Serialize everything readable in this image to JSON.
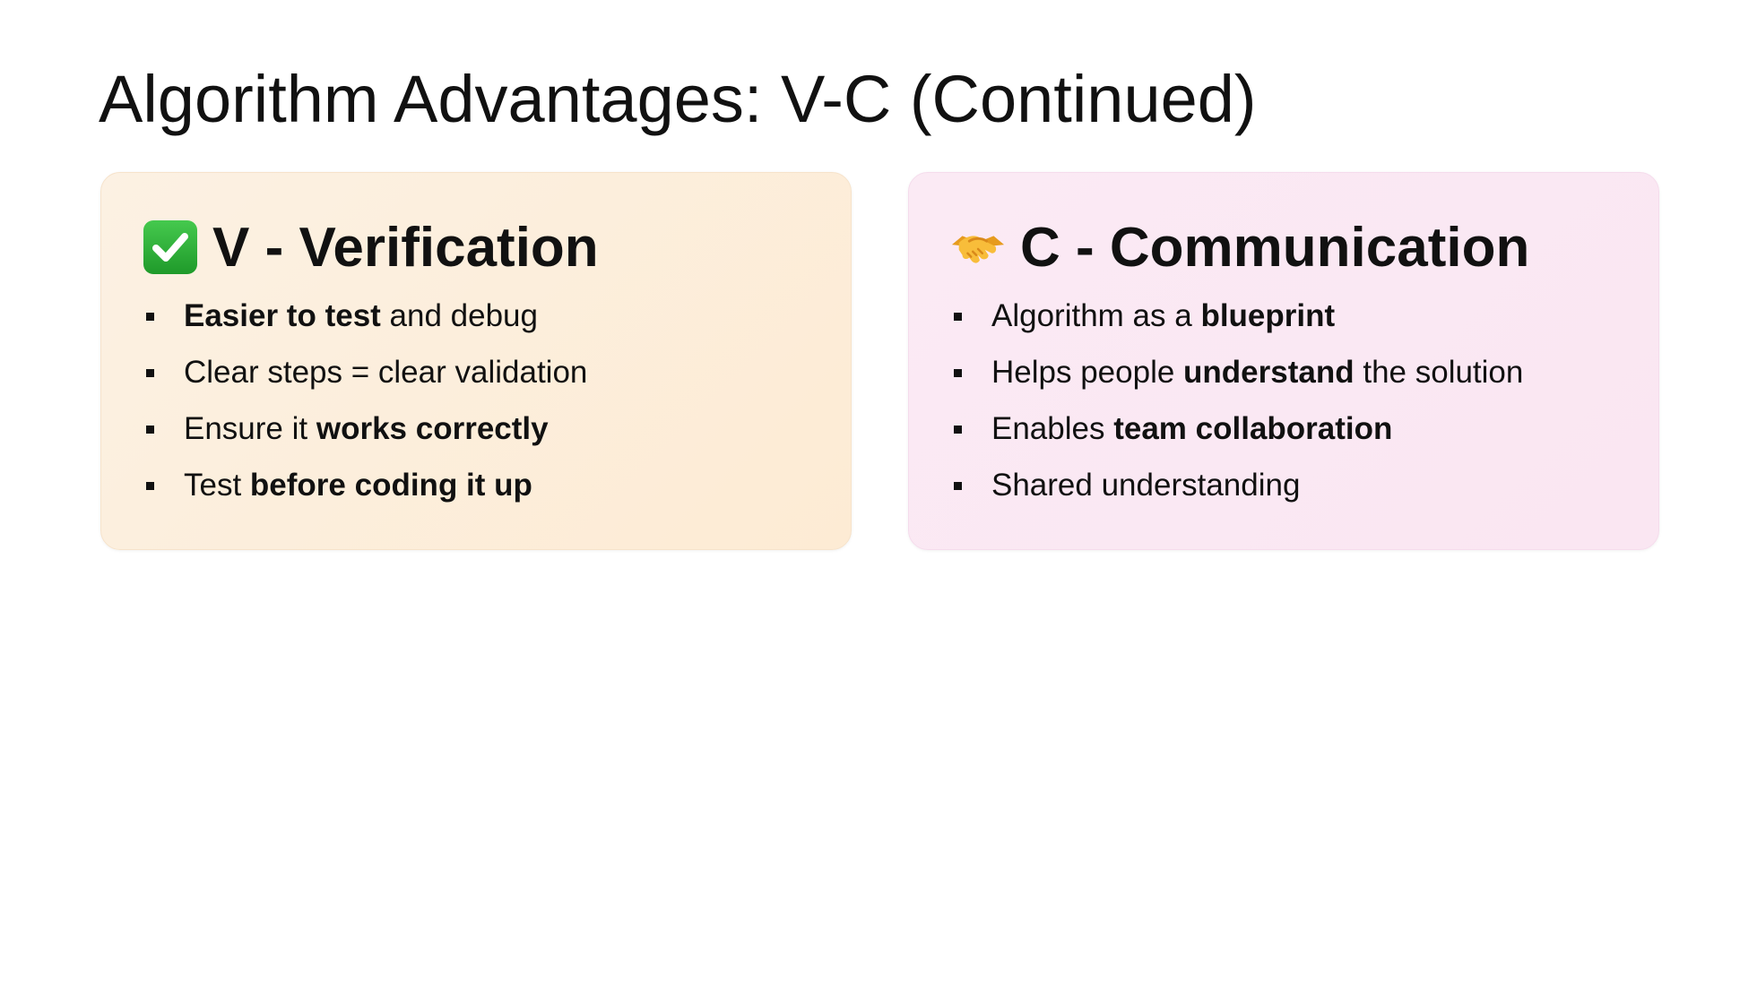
{
  "slide": {
    "title": "Algorithm Advantages: V-C (Continued)"
  },
  "cards": [
    {
      "heading": "V - Verification",
      "icon": "check-mark-box-icon",
      "accent": "#2fb33a",
      "items": [
        [
          {
            "t": "Easier to test",
            "b": true
          },
          {
            "t": " and debug",
            "b": false
          }
        ],
        [
          {
            "t": "Clear steps = clear validation",
            "b": false
          }
        ],
        [
          {
            "t": "Ensure it ",
            "b": false
          },
          {
            "t": "works correctly",
            "b": true
          }
        ],
        [
          {
            "t": "Test ",
            "b": false
          },
          {
            "t": "before coding it up",
            "b": true
          }
        ]
      ]
    },
    {
      "heading": "C - Communication",
      "icon": "handshake-icon",
      "accent": "#f7b733",
      "items": [
        [
          {
            "t": "Algorithm as a ",
            "b": false
          },
          {
            "t": "blueprint",
            "b": true
          }
        ],
        [
          {
            "t": "Helps people ",
            "b": false
          },
          {
            "t": "understand",
            "b": true
          },
          {
            "t": " the solution",
            "b": false
          }
        ],
        [
          {
            "t": "Enables ",
            "b": false
          },
          {
            "t": "team collaboration",
            "b": true
          }
        ],
        [
          {
            "t": "Shared understanding",
            "b": false
          }
        ]
      ]
    }
  ],
  "colors": {
    "card_v_bg": "#fdefdc",
    "card_c_bg": "#fbe8f3",
    "text": "#111111"
  }
}
